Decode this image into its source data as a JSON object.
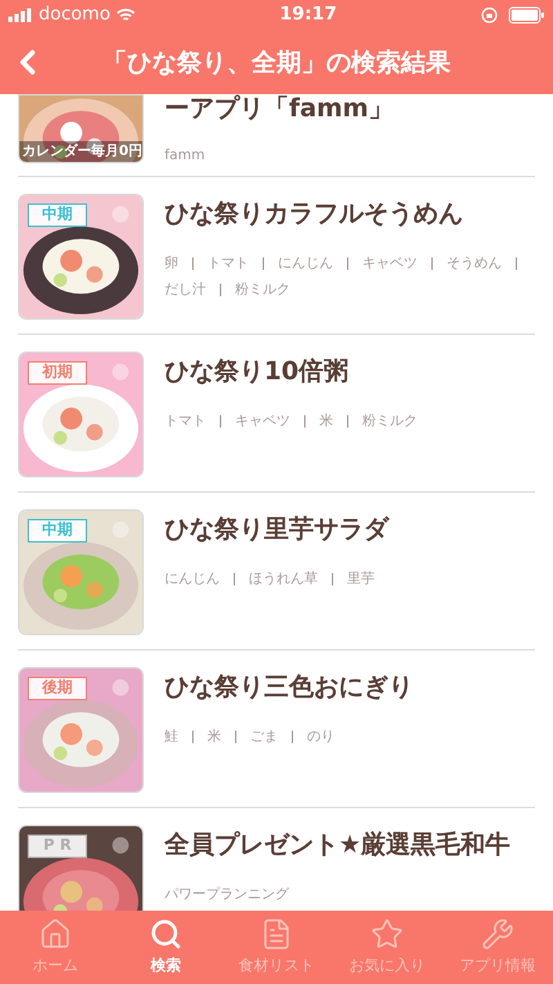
{
  "status_bar": {
    "carrier": "docomo",
    "time": "19:17"
  },
  "header": {
    "title": "「ひな祭り、全期」の検索結果"
  },
  "results": [
    {
      "title": "ーアプリ「famm」",
      "tags": [
        "famm"
      ],
      "picture_caption": "カレンダー毎月0円"
    },
    {
      "title": "ひな祭りカラフルそうめん",
      "badge": {
        "label": "中期",
        "color": "#3bbfd3"
      },
      "tags": [
        "卵",
        "トマト",
        "にんじん",
        "キャベツ",
        "そうめん",
        "だし汁",
        "粉ミルク"
      ]
    },
    {
      "title": "ひな祭り10倍粥",
      "badge": {
        "label": "初期",
        "color": "#f2806e"
      },
      "tags": [
        "トマト",
        "キャベツ",
        "米",
        "粉ミルク"
      ]
    },
    {
      "title": "ひな祭り里芋サラダ",
      "badge": {
        "label": "中期",
        "color": "#3bbfd3"
      },
      "tags": [
        "にんじん",
        "ほうれん草",
        "里芋"
      ]
    },
    {
      "title": "ひな祭り三色おにぎり",
      "badge": {
        "label": "後期",
        "color": "#f2806e"
      },
      "tags": [
        "鮭",
        "米",
        "ごま",
        "のり"
      ]
    },
    {
      "title": "全員プレゼント★厳選黒毛和牛",
      "badge": {
        "label": "P R",
        "color": "#b0b0b0"
      },
      "tags": [
        "パワープランニング"
      ]
    }
  ],
  "tab_bar": [
    {
      "label": "ホーム",
      "kind": "home",
      "selected": false
    },
    {
      "label": "検索",
      "kind": "search",
      "selected": true
    },
    {
      "label": "食材リスト",
      "kind": "list",
      "selected": false
    },
    {
      "label": "お気に入り",
      "kind": "star",
      "selected": false
    },
    {
      "label": "アプリ情報",
      "kind": "wrench",
      "selected": false
    }
  ]
}
